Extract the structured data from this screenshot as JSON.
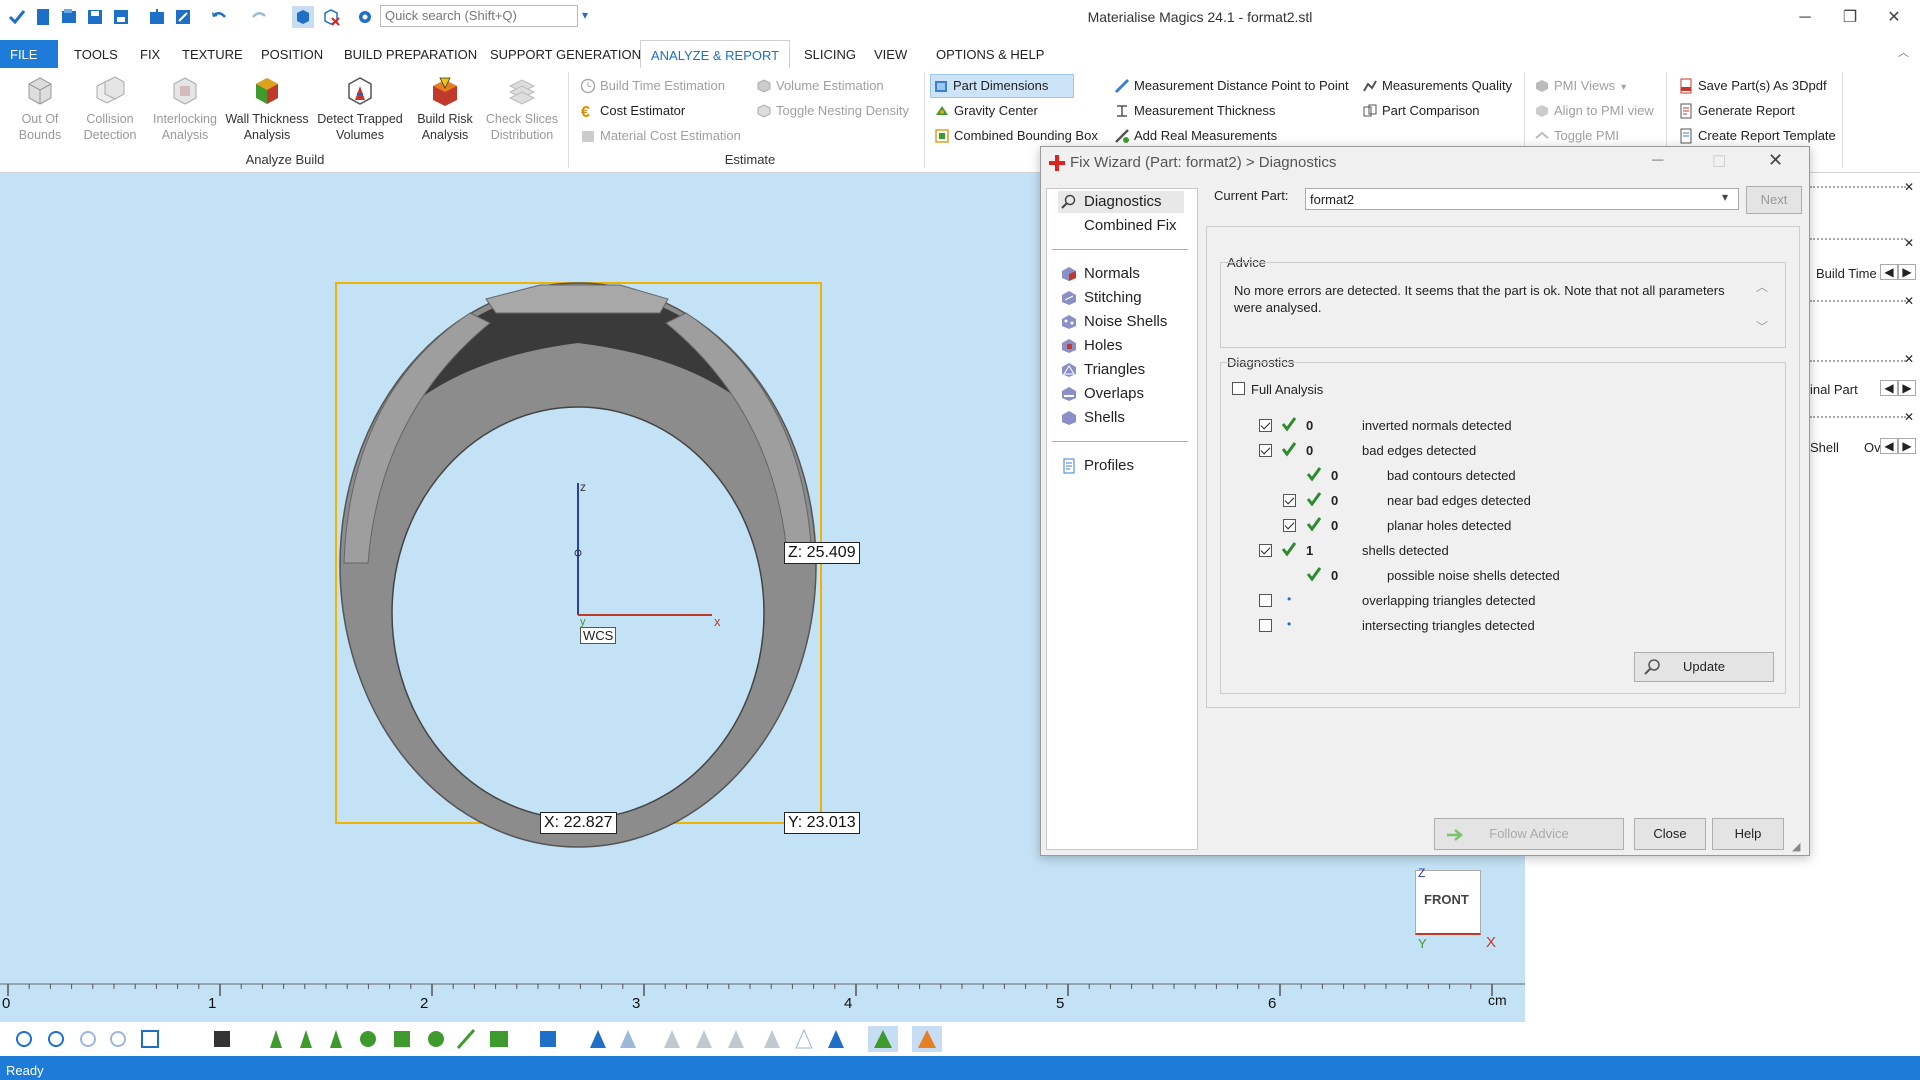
{
  "window": {
    "title": "Materialise Magics 24.1 - format2.stl",
    "search_placeholder": "Quick search (Shift+Q)"
  },
  "menu": [
    "FILE",
    "TOOLS",
    "FIX",
    "TEXTURE",
    "POSITION",
    "BUILD PREPARATION",
    "SUPPORT GENERATION",
    "ANALYZE & REPORT",
    "SLICING",
    "VIEW",
    "OPTIONS & HELP"
  ],
  "menu_active": "ANALYZE & REPORT",
  "ribbon": {
    "analyze_build": {
      "label": "Analyze Build",
      "buttons": [
        {
          "line1": "Out Of",
          "line2": "Bounds"
        },
        {
          "line1": "Collision",
          "line2": "Detection"
        },
        {
          "line1": "Interlocking",
          "line2": "Analysis"
        },
        {
          "line1": "Wall Thickness",
          "line2": "Analysis"
        },
        {
          "line1": "Detect Trapped",
          "line2": "Volumes"
        },
        {
          "line1": "Build Risk",
          "line2": "Analysis"
        },
        {
          "line1": "Check Slices",
          "line2": "Distribution"
        }
      ]
    },
    "estimate": {
      "label": "Estimate",
      "items": [
        "Build Time Estimation",
        "Cost Estimator",
        "Material Cost Estimation",
        "Volume Estimation",
        "Toggle Nesting Density"
      ]
    },
    "measure": {
      "items": [
        "Part Dimensions",
        "Gravity Center",
        "Combined Bounding Box",
        "Measurement Distance Point to Point",
        "Measurement Thickness",
        "Add Real Measurements",
        "Measurements Quality",
        "Part Comparison"
      ]
    },
    "pmi": {
      "items": [
        "PMI Views",
        "Align to PMI view",
        "Toggle PMI"
      ]
    },
    "report": {
      "items": [
        "Save Part(s) As 3Dpdf",
        "Generate Report",
        "Create Report Template"
      ]
    }
  },
  "viewport": {
    "axis_z": "z",
    "axis_x": "x",
    "axis_y": "y",
    "wcs": "WCS",
    "dim_z": "Z: 25.409",
    "dim_x": "X: 22.827",
    "dim_y": "Y: 23.013",
    "viewcube_label": "FRONT",
    "viewcube_z": "Z",
    "viewcube_y": "Y",
    "viewcube_x": "X"
  },
  "ruler": {
    "ticks": [
      "0",
      "1",
      "2",
      "3",
      "4",
      "5",
      "6"
    ],
    "unit": "cm"
  },
  "right_panel": {
    "rows": [
      "Build Time",
      "inal Part",
      "Shell",
      "Ov"
    ]
  },
  "dialog": {
    "title": "Fix Wizard (Part: format2) > Diagnostics",
    "nav_top": [
      "Diagnostics",
      "Combined Fix"
    ],
    "nav_mid": [
      "Normals",
      "Stitching",
      "Noise Shells",
      "Holes",
      "Triangles",
      "Overlaps",
      "Shells"
    ],
    "nav_bottom": [
      "Profiles"
    ],
    "current_part_label": "Current Part:",
    "current_part_value": "format2",
    "next_label": "Next",
    "advice_label": "Advice",
    "advice_text": "No more errors are detected. It seems that the part is ok. Note that not all parameters were analysed.",
    "diagnostics_label": "Diagnostics",
    "full_analysis_label": "Full Analysis",
    "rows": [
      {
        "checked": true,
        "count": "0",
        "label": "inverted normals detected",
        "indent": 0
      },
      {
        "checked": true,
        "count": "0",
        "label": "bad edges detected",
        "indent": 0
      },
      {
        "checked": null,
        "count": "0",
        "label": "bad contours detected",
        "indent": 1
      },
      {
        "checked": true,
        "count": "0",
        "label": "near bad edges detected",
        "indent": 1
      },
      {
        "checked": true,
        "count": "0",
        "label": "planar holes detected",
        "indent": 1
      },
      {
        "checked": true,
        "count": "1",
        "label": "shells detected",
        "indent": 0
      },
      {
        "checked": null,
        "count": "0",
        "label": "possible noise shells detected",
        "indent": 1
      },
      {
        "checked": false,
        "count": "",
        "label": "overlapping triangles detected",
        "indent": 0
      },
      {
        "checked": false,
        "count": "",
        "label": "intersecting triangles detected",
        "indent": 0
      }
    ],
    "update_label": "Update",
    "follow_advice_label": "Follow Advice",
    "close_label": "Close",
    "help_label": "Help"
  },
  "status": "Ready",
  "colors": {
    "accent": "#1e7bd8",
    "viewport": "#c4e2f5",
    "check": "#2e8b2e",
    "bbox": "#f0b400"
  }
}
